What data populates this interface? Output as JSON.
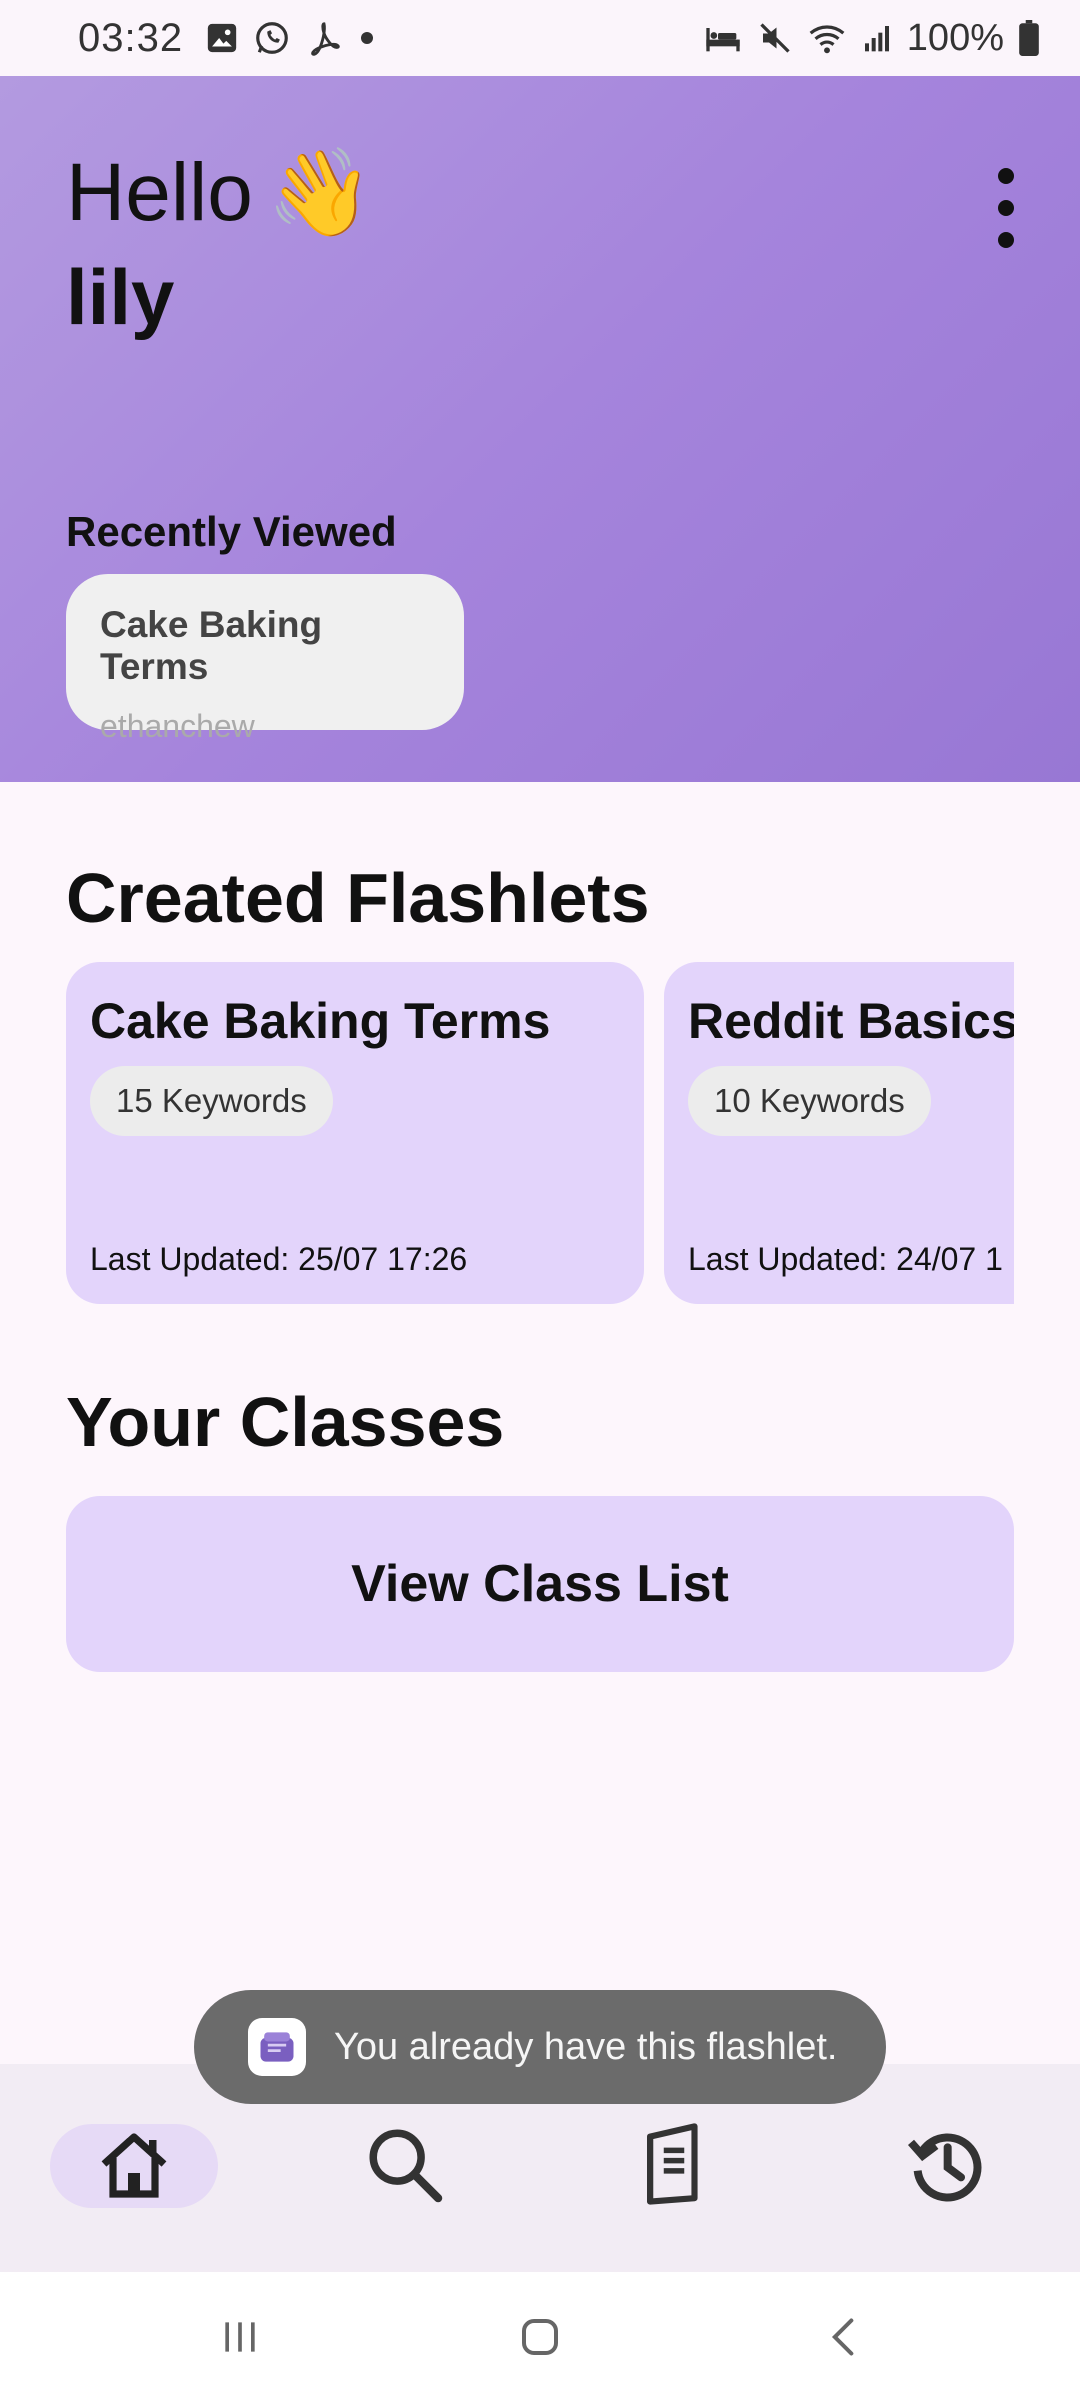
{
  "status_bar": {
    "time": "03:32",
    "left_icons": [
      "gallery-icon",
      "whatsapp-icon",
      "acrobat-icon",
      "dot-icon"
    ],
    "right_icons": [
      "bed-icon",
      "mute-icon",
      "wifi-icon",
      "signal-icon",
      "battery-icon"
    ],
    "battery": "100%"
  },
  "header": {
    "greeting": "Hello",
    "wave_emoji": "👋",
    "user_name": "lily",
    "more_icon": "more-vert-icon",
    "recently_viewed_title": "Recently Viewed",
    "recent_card": {
      "title": "Cake Baking Terms",
      "author": "ethanchew"
    }
  },
  "created": {
    "title": "Created Flashlets",
    "cards": [
      {
        "title": "Cake Baking Terms",
        "keywords": "15 Keywords",
        "updated": "Last Updated: 25/07 17:26"
      },
      {
        "title": "Reddit Basics",
        "keywords": "10 Keywords",
        "updated": "Last Updated: 24/07 1"
      }
    ]
  },
  "classes": {
    "title": "Your Classes",
    "button_label": "View Class List"
  },
  "toast": {
    "message": "You already have this flashlet."
  },
  "bottom_nav": {
    "items": [
      "home-icon",
      "search-icon",
      "book-icon",
      "history-icon"
    ],
    "active": "home-icon"
  },
  "colors": {
    "header_gradient_start": "#b39ae0",
    "header_gradient_end": "#9877d4",
    "card_bg": "#e3d4fb",
    "page_bg": "#fdf6fc",
    "nav_bg": "#f2ecf4",
    "toast_bg": "#6b6b6b"
  }
}
